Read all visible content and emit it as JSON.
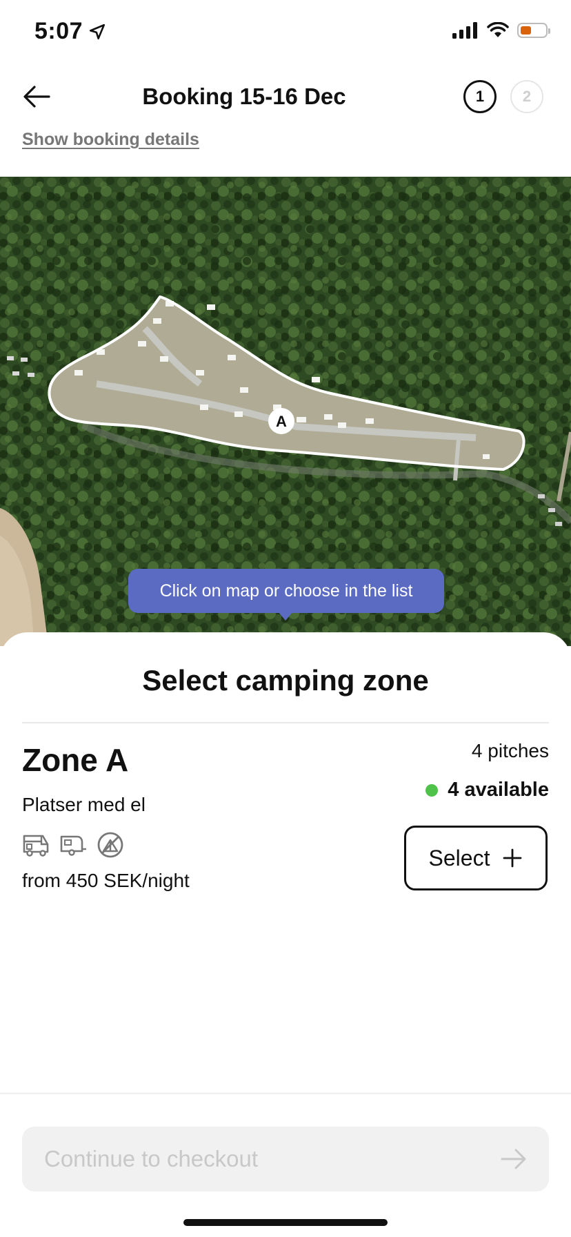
{
  "status_bar": {
    "time": "5:07",
    "battery_color": "#d9620b"
  },
  "header": {
    "title": "Booking 15-16 Dec",
    "steps": [
      "1",
      "2"
    ],
    "details_link": "Show booking details"
  },
  "map": {
    "zone_marker": "A",
    "tooltip": "Click on map or choose in the list"
  },
  "sheet": {
    "title": "Select camping zone",
    "zone": {
      "name": "Zone A",
      "description": "Platser med el",
      "amenity_icons": [
        "motorhome-icon",
        "caravan-icon",
        "no-tent-icon"
      ],
      "price": "from 450 SEK/night",
      "pitches": "4 pitches",
      "available": "4 available",
      "available_color": "#4fc24a",
      "select_label": "Select"
    }
  },
  "footer": {
    "checkout_label": "Continue to checkout"
  },
  "colors": {
    "accent": "#5b6bc2"
  }
}
